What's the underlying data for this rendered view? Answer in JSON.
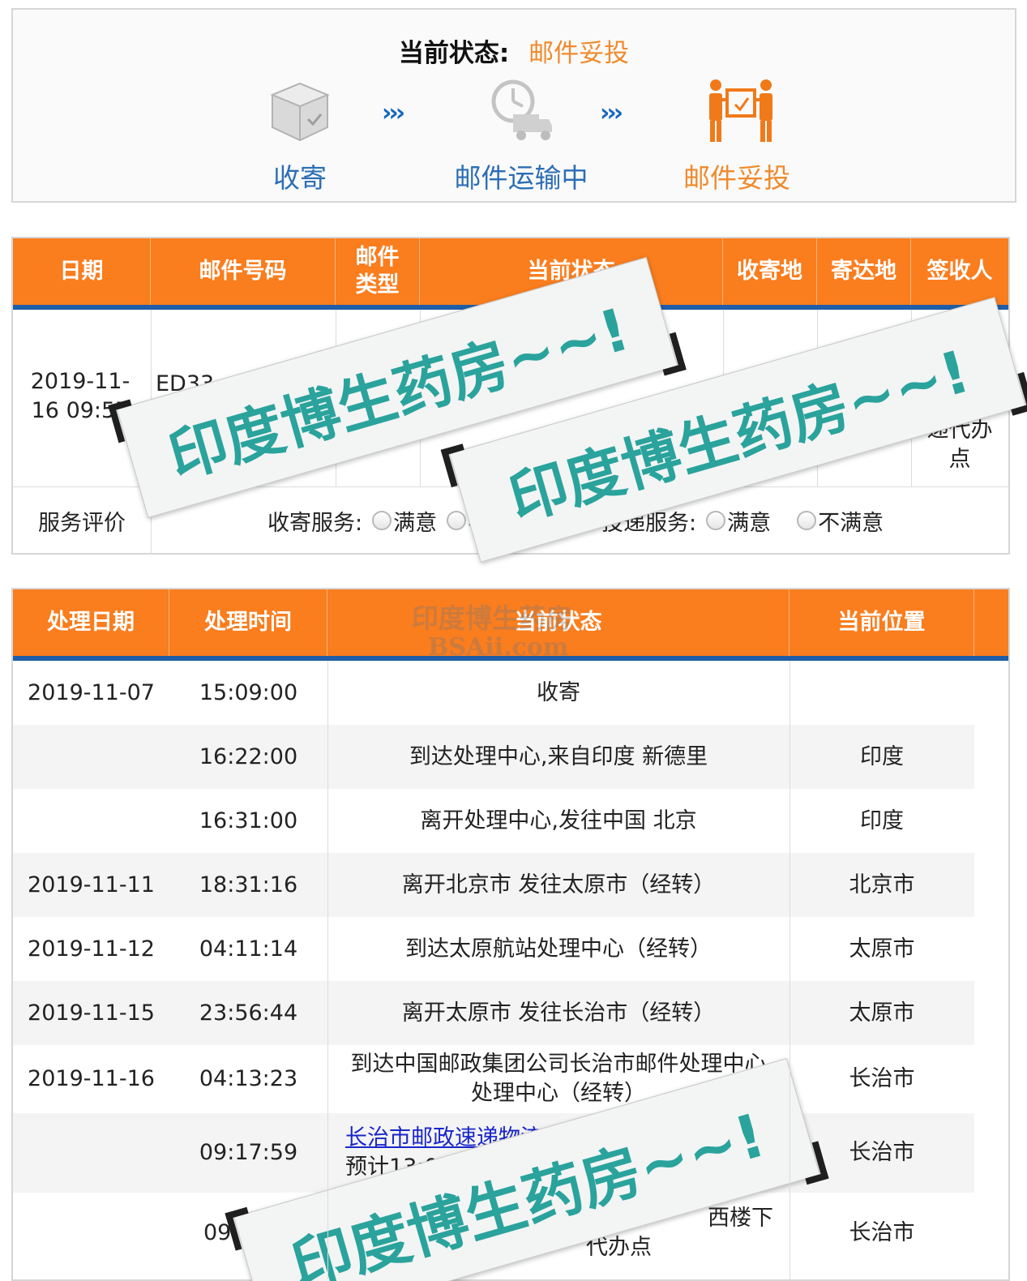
{
  "status": {
    "label": "当前状态:",
    "value": "邮件妥投",
    "steps": [
      {
        "label": "收寄",
        "icon": "package-icon"
      },
      {
        "label": "邮件运输中",
        "icon": "truck-clock-icon"
      },
      {
        "label": "邮件妥投",
        "icon": "delivery-people-icon"
      }
    ],
    "arrow_glyph": "›››"
  },
  "summary_table": {
    "headers": [
      "日期",
      "邮件号码",
      "邮件类型",
      "当前状态",
      "收寄地",
      "寄达地",
      "签收人"
    ],
    "row": {
      "date": "2019-11-16 09:57",
      "number": "ED33",
      "signer": "递代办点"
    },
    "evaluation": {
      "label": "服务评价",
      "pickup_label": "收寄服务:",
      "delivery_label": "投递服务:",
      "satisfied": "满意",
      "unsatisfied": "不满意"
    }
  },
  "tracking_table": {
    "headers": [
      "处理日期",
      "处理时间",
      "当前状态",
      "当前位置"
    ],
    "rows": [
      {
        "date": "2019-11-07",
        "time": "15:09:00",
        "status": "收寄",
        "location": ""
      },
      {
        "date": "",
        "time": "16:22:00",
        "status": "到达处理中心,来自印度 新德里",
        "location": "印度"
      },
      {
        "date": "",
        "time": "16:31:00",
        "status": "离开处理中心,发往中国 北京",
        "location": "印度"
      },
      {
        "date": "2019-11-11",
        "time": "18:31:16",
        "status": "离开北京市 发往太原市（经转）",
        "location": "北京市"
      },
      {
        "date": "2019-11-12",
        "time": "04:11:14",
        "status": "到达太原航站处理中心（经转）",
        "location": "太原市"
      },
      {
        "date": "2019-11-15",
        "time": "23:56:44",
        "status": "离开太原市 发往长治市（经转）",
        "location": "太原市"
      },
      {
        "date": "2019-11-16",
        "time": "04:13:23",
        "status_line1": "到达中国邮政集团公司长治市邮件处理中心",
        "status_line2": "处理中心（经转）",
        "location": "长治市"
      },
      {
        "date": "",
        "time": "09:17:59",
        "status_link": "长治市邮政速递物流",
        "status_line2": "预计13:00",
        "location": "长治市"
      },
      {
        "date": "",
        "time": "09:5",
        "status_line1": "西楼下",
        "status_line2": "代办点",
        "location": "长治市"
      }
    ]
  },
  "watermark": {
    "sticker_text": "印度博生药房~~!",
    "faint_line1": "印度博生药房",
    "faint_line2": "BSAii.com"
  }
}
